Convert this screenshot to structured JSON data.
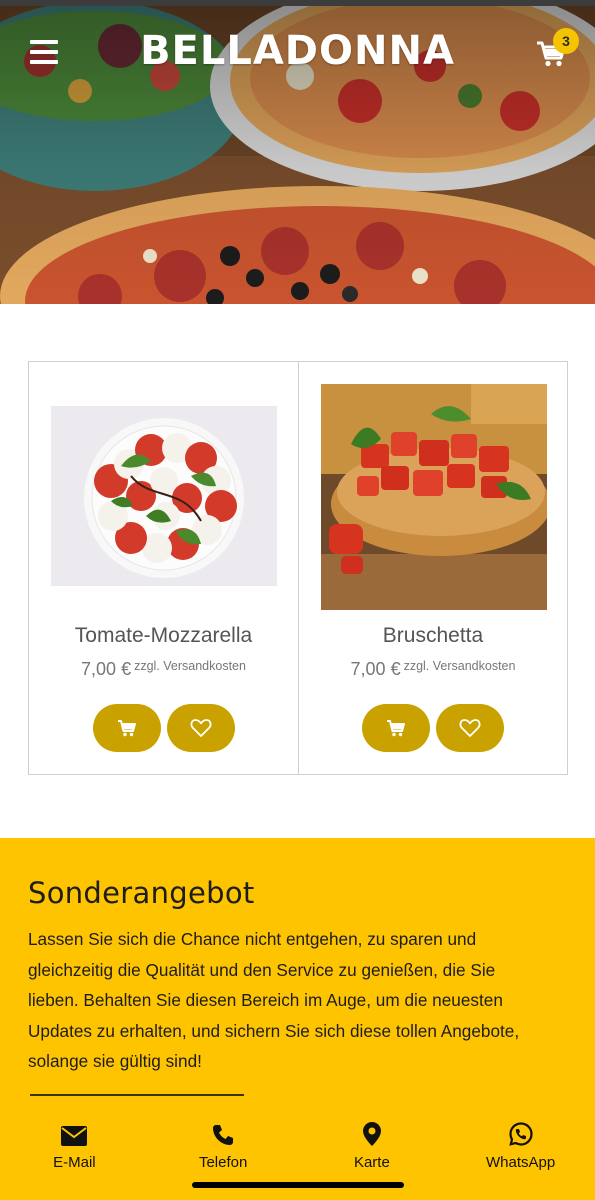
{
  "header": {
    "brand": "BELLADONNA",
    "cart_count": "3",
    "menu_icon": "hamburger-menu-icon",
    "cart_icon": "shopping-cart-icon"
  },
  "products": [
    {
      "name": "Tomate-Mozzarella",
      "price": "7,00 €",
      "shipping_note": "zzgl. Versandkosten",
      "image": "tomato-mozzarella-plate-image",
      "actions": [
        "add-to-cart-icon",
        "heart-icon"
      ]
    },
    {
      "name": "Bruschetta",
      "price": "7,00 €",
      "shipping_note": "zzgl. Versandkosten",
      "image": "bruschetta-image",
      "actions": [
        "add-to-cart-icon",
        "heart-icon"
      ]
    }
  ],
  "offer": {
    "title": "Sonderangebot",
    "text": "Lassen Sie sich die Chance nicht entgehen, zu sparen und gleichzeitig die Qualität und den Service zu genießen, die Sie lieben. Behalten Sie diesen Bereich im Auge, um die neuesten Updates zu erhalten, und sichern Sie sich diese tollen Angebote, solange sie gültig sind!"
  },
  "bottom_nav": [
    {
      "label": "E-Mail",
      "icon": "envelope-icon"
    },
    {
      "label": "Telefon",
      "icon": "phone-icon"
    },
    {
      "label": "Karte",
      "icon": "map-pin-icon"
    },
    {
      "label": "WhatsApp",
      "icon": "whatsapp-icon"
    }
  ],
  "colors": {
    "accent": "#ffc400",
    "button": "#c9a200",
    "badge": "#f5c400",
    "text_dark": "#1d1d1d",
    "text_muted": "#777777"
  }
}
